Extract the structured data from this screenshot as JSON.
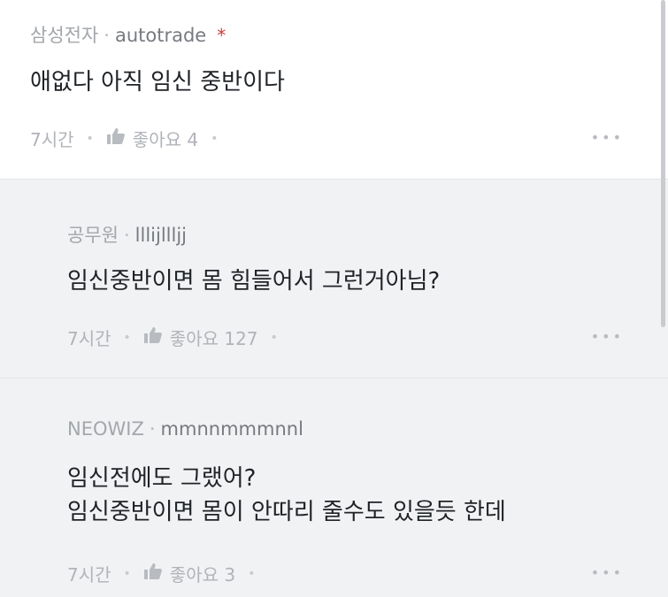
{
  "comments": [
    {
      "gallery": "삼성전자",
      "user": "autotrade",
      "star": "*",
      "lines": [
        "애없다 아직 임신 중반이다"
      ],
      "time": "7시간",
      "likes_label": "좋아요 4",
      "more": "•••"
    },
    {
      "gallery": "공무원",
      "user": "lllijllljj",
      "lines": [
        "임신중반이면 몸 힘들어서 그런거아님?"
      ],
      "time": "7시간",
      "likes_label": "좋아요 127",
      "more": "•••"
    },
    {
      "gallery": "NEOWIZ",
      "user": "mmnnmmmnnl",
      "lines": [
        "임신전에도 그랬어?",
        "임신중반이면 몸이 안따리 줄수도 있을듯 한데"
      ],
      "time": "7시간",
      "likes_label": "좋아요 3",
      "more": "•••"
    }
  ],
  "separator": "·",
  "icons": {
    "like": "thumbs-up-icon",
    "more": "more-dots-icon"
  },
  "colors": {
    "top_bg": "#ffffff",
    "reply_bg": "#f1f2f4",
    "star": "#d23a3a"
  }
}
